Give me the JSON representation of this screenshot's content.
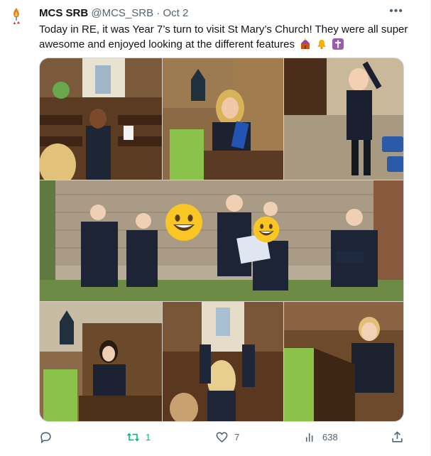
{
  "account": {
    "display_name": "MCS SRB",
    "handle": "@MCS_SRB",
    "separator": "·",
    "date": "Oct 2"
  },
  "tweet": {
    "text": "Today in RE, it was Year 7’s turn to visit St Mary’s Church! They were all super awesome and enjoyed looking at the different features",
    "emojis": [
      "church-emoji",
      "bell-emoji",
      "cross-emoji"
    ]
  },
  "media": {
    "photo_count": 7,
    "face_cover_emoji": "smiling-face-emoji"
  },
  "metrics": {
    "replies": "",
    "retweets": "1",
    "likes": "7",
    "views": "638"
  },
  "colors": {
    "text": "#0f1419",
    "secondary": "#536471",
    "retweet_active": "#00ba7c",
    "border": "#cfd9de"
  }
}
